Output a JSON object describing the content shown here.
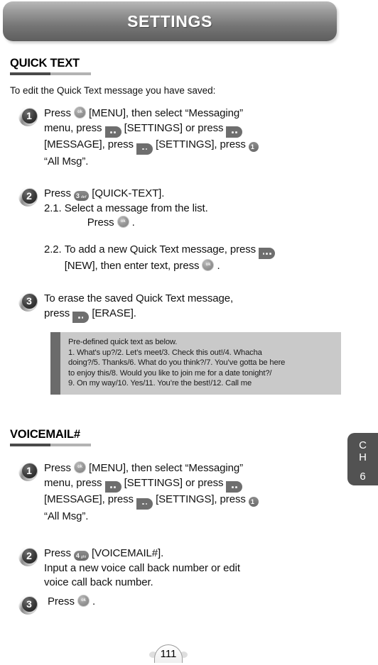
{
  "header": {
    "title": "SETTINGS"
  },
  "chapter_tab": {
    "line1": "C",
    "line2": "H",
    "number": "6"
  },
  "footer": {
    "page_number": "111"
  },
  "sections": [
    {
      "heading": "QUICK TEXT",
      "intro": "To edit the Quick Text message you have saved:",
      "steps": [
        {
          "number": "1",
          "lines": [
            "Press ",
            " [MENU], then select “Messaging”",
            "menu, press ",
            " [SETTINGS] or press ",
            "[MESSAGE], press ",
            " [SETTINGS], press ",
            "“All Msg”."
          ]
        },
        {
          "number": "2",
          "lines": [
            "Press ",
            " [QUICK-TEXT].",
            "2.1. ",
            "Select a message from the list.",
            "Press ",
            " .",
            "2.2. ",
            "To add a new Quick Text message, press ",
            "[NEW], then enter text, press ",
            " ."
          ]
        },
        {
          "number": "3",
          "lines": [
            "To erase the saved Quick Text message,",
            "press ",
            " [ERASE]."
          ]
        }
      ],
      "note": {
        "line1": "Pre-defined quick text as below.",
        "line2": "1. What's up?/2. Let’s meet/3. Check this out!/4. Whacha",
        "line3": "doing?/5. Thanks/6. What do you think?/7. You’ve gotta be here",
        "line4": "to enjoy this/8. Would you like to join me for a date tonight?/",
        "line5": "9. On my way/10. Yes/11. You’re the best!/12. Call me"
      }
    },
    {
      "heading": "VOICEMAIL#",
      "steps": [
        {
          "number": "1",
          "lines": [
            "Press ",
            " [MENU], then select “Messaging”",
            "menu, press ",
            " [SETTINGS] or press ",
            "[MESSAGE], press ",
            " [SETTINGS], press ",
            "“All Msg”."
          ]
        },
        {
          "number": "2",
          "lines": [
            "Press ",
            " [VOICEMAIL#].",
            "Input a new voice call back number or edit",
            "voice call back number."
          ]
        },
        {
          "number": "3",
          "lines": [
            "Press ",
            " ."
          ]
        }
      ]
    }
  ],
  "keys": {
    "ok": "ok",
    "num1": {
      "digit": "1",
      "letters": ""
    },
    "num3": {
      "digit": "3",
      "letters": "def"
    },
    "num4": {
      "digit": "4",
      "letters": "ghi"
    }
  }
}
